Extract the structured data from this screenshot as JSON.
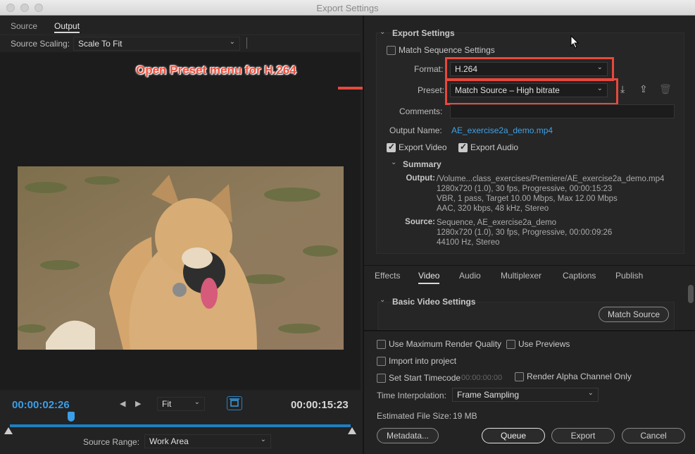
{
  "window": {
    "title": "Export Settings"
  },
  "left": {
    "tabs": [
      "Source",
      "Output"
    ],
    "source_scaling_label": "Source Scaling:",
    "source_scaling_value": "Scale To Fit",
    "current_time": "00:00:02:26",
    "duration": "00:00:15:23",
    "zoom_value": "Fit",
    "source_range_label": "Source Range:",
    "source_range_value": "Work Area",
    "playhead_fraction": 0.18
  },
  "export": {
    "section_title": "Export Settings",
    "match_sequence_label": "Match Sequence Settings",
    "format_label": "Format:",
    "format_value": "H.264",
    "preset_label": "Preset:",
    "preset_value": "Match Source – High bitrate",
    "comments_label": "Comments:",
    "output_name_label": "Output Name:",
    "output_name_value": "AE_exercise2a_demo.mp4",
    "export_video_label": "Export Video",
    "export_audio_label": "Export Audio"
  },
  "summary": {
    "title": "Summary",
    "output_key": "Output:",
    "output_lines": [
      "/Volume...class_exercises/Premiere/AE_exercise2a_demo.mp4",
      "1280x720 (1.0), 30 fps, Progressive, 00:00:15:23",
      "VBR, 1 pass, Target 10.00 Mbps, Max 12.00 Mbps",
      "AAC, 320 kbps, 48 kHz, Stereo"
    ],
    "source_key": "Source:",
    "source_lines": [
      "Sequence, AE_exercise2a_demo",
      "1280x720 (1.0), 30 fps, Progressive, 00:00:09:26",
      "44100 Hz, Stereo"
    ]
  },
  "tabs": [
    "Effects",
    "Video",
    "Audio",
    "Multiplexer",
    "Captions",
    "Publish"
  ],
  "video": {
    "section_title": "Basic Video Settings",
    "match_source_button": "Match Source"
  },
  "bottom": {
    "max_render_quality": "Use Maximum Render Quality",
    "use_previews": "Use Previews",
    "import_into_project": "Import into project",
    "set_start_timecode": "Set Start Timecode",
    "start_timecode_value": "00:00:00:00",
    "render_alpha": "Render Alpha Channel Only",
    "time_interp_label": "Time Interpolation:",
    "time_interp_value": "Frame Sampling",
    "est_size_label": "Estimated File Size:",
    "est_size_value": "19 MB",
    "metadata_button": "Metadata...",
    "queue_button": "Queue",
    "export_button": "Export",
    "cancel_button": "Cancel"
  },
  "annotation": {
    "text": "Open Preset menu for H.264"
  },
  "colors": {
    "accent": "#1e7fc0",
    "link": "#3ea2e8",
    "highlight": "#e8483d",
    "timecode": "#3b9ee6"
  }
}
